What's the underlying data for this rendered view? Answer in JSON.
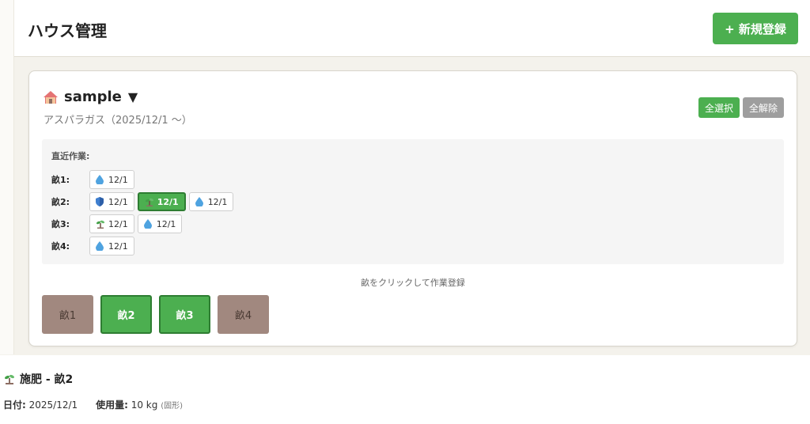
{
  "header": {
    "title": "ハウス管理",
    "new_button": "+ 新規登録"
  },
  "house": {
    "name": "sample",
    "toggle": "▼",
    "crop": "アスパラガス（2025/12/1 〜）",
    "select_all": "全選択",
    "clear_all": "全解除",
    "recent_label": "直近作業:",
    "rows": [
      {
        "bed": "畝1:",
        "chips": [
          {
            "icon": "water-drop-icon",
            "date": "12/1",
            "active": false
          }
        ]
      },
      {
        "bed": "畝2:",
        "chips": [
          {
            "icon": "shield-icon",
            "date": "12/1",
            "active": false
          },
          {
            "icon": "sprout-icon",
            "date": "12/1",
            "active": true
          },
          {
            "icon": "water-drop-icon",
            "date": "12/1",
            "active": false
          }
        ]
      },
      {
        "bed": "畝3:",
        "chips": [
          {
            "icon": "sprout-icon",
            "date": "12/1",
            "active": false
          },
          {
            "icon": "water-drop-icon",
            "date": "12/1",
            "active": false
          }
        ]
      },
      {
        "bed": "畝4:",
        "chips": [
          {
            "icon": "water-drop-icon",
            "date": "12/1",
            "active": false
          }
        ]
      }
    ],
    "hint": "畝をクリックして作業登録",
    "beds": [
      {
        "label": "畝1",
        "selected": false
      },
      {
        "label": "畝2",
        "selected": true
      },
      {
        "label": "畝3",
        "selected": true
      },
      {
        "label": "畝4",
        "selected": false
      }
    ]
  },
  "detail": {
    "title": "施肥 - 畝2",
    "date_label": "日付:",
    "date_value": "2025/12/1",
    "amount_label": "使用量:",
    "amount_value": "10 kg",
    "amount_note": "(固形)"
  },
  "colors": {
    "accent": "#4caf50",
    "accent_dark": "#2e7d32",
    "bed_off": "#a1887f",
    "clear": "#9e9e9e"
  }
}
